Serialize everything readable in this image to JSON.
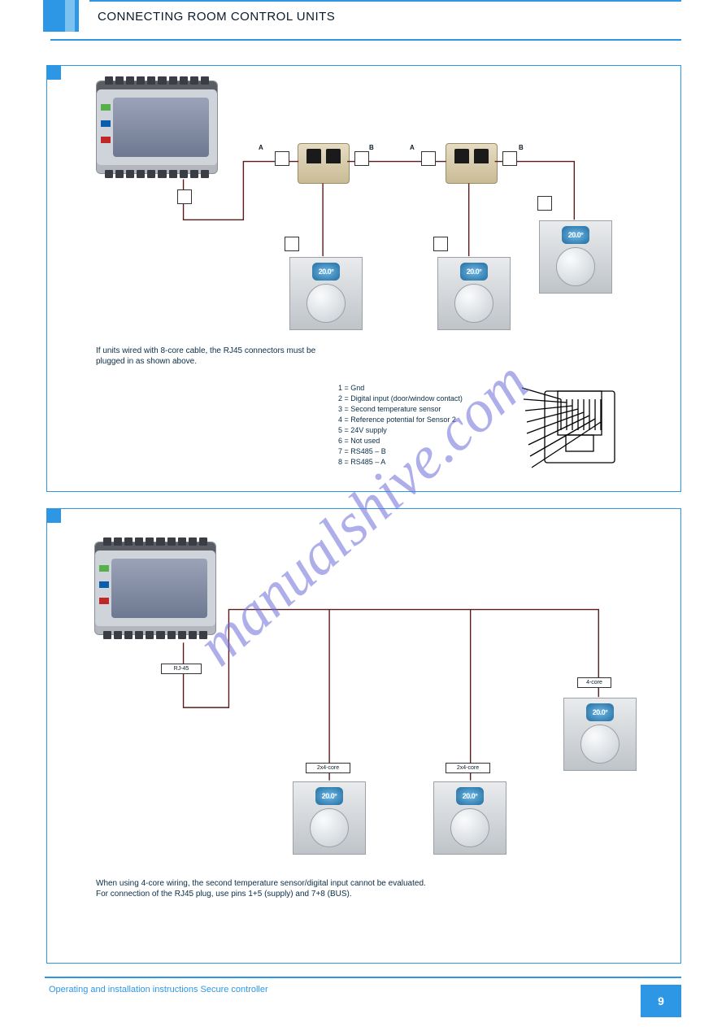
{
  "page": {
    "section_title": "CONNECTING ROOM CONTROL UNITS",
    "footer_left": "Operating and installation instructions Secure controller",
    "page_number": "9"
  },
  "watermark": "manualshive.com",
  "figure1": {
    "caption_line1": "If units wired with 8-core cable, the RJ45 connectors must be",
    "caption_line2": "plugged in as shown above.",
    "cable_a": "A",
    "cable_b": "B",
    "pins": {
      "p1": "Gnd",
      "p2": "Digital input (door/window contact)",
      "p3": "Second temperature sensor",
      "p4": "Reference potential for Sensor 2",
      "p5": "24V supply",
      "p6": "Not used",
      "p7": "RS485 – B",
      "p8": "RS485 – A"
    }
  },
  "figure2": {
    "caption_line1": "When using 4-core wiring, the second temperature sensor/digital input cannot be evaluated.",
    "caption_line2": "For connection of the RJ45 plug, use pins 1+5 (supply) and 7+8 (BUS).",
    "labels": {
      "rj45": "RJ-45",
      "tstat1": "2x4-core",
      "tstat2": "2x4-core",
      "tstat_last": "4-core"
    }
  },
  "common": {
    "lcd_reading": "20.0°"
  }
}
